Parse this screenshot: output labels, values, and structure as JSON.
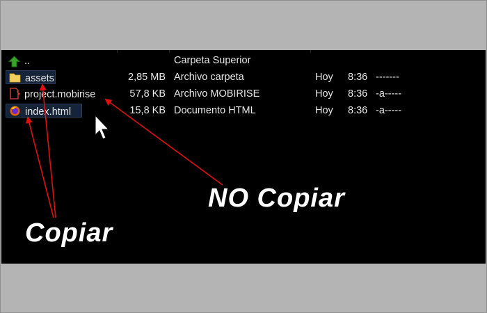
{
  "files": [
    {
      "icon": "parent-folder-icon",
      "name": "..",
      "size": "",
      "type": "Carpeta Superior",
      "date": "",
      "time": "",
      "attr": "",
      "selected": false
    },
    {
      "icon": "folder-icon",
      "name": "assets",
      "size": "2,85 MB",
      "type": "Archivo carpeta",
      "date": "Hoy",
      "time": "8:36",
      "attr": "-------",
      "selected": true
    },
    {
      "icon": "mobirise-file-icon",
      "name": "project.mobirise",
      "size": "57,8 KB",
      "type": "Archivo MOBIRISE",
      "date": "Hoy",
      "time": "8:36",
      "attr": "-a-----",
      "selected": false
    },
    {
      "icon": "firefox-html-icon",
      "name": "index.html",
      "size": "15,8 KB",
      "type": "Documento HTML",
      "date": "Hoy",
      "time": "8:36",
      "attr": "-a-----",
      "selected": true
    }
  ],
  "annotations": {
    "no_copiar": "NO Copiar",
    "copiar": "Copiar"
  },
  "colors": {
    "arrow": "#e01010",
    "background_panel": "#000000",
    "background_frame": "#b4b4b4",
    "selection": "#16243a"
  }
}
